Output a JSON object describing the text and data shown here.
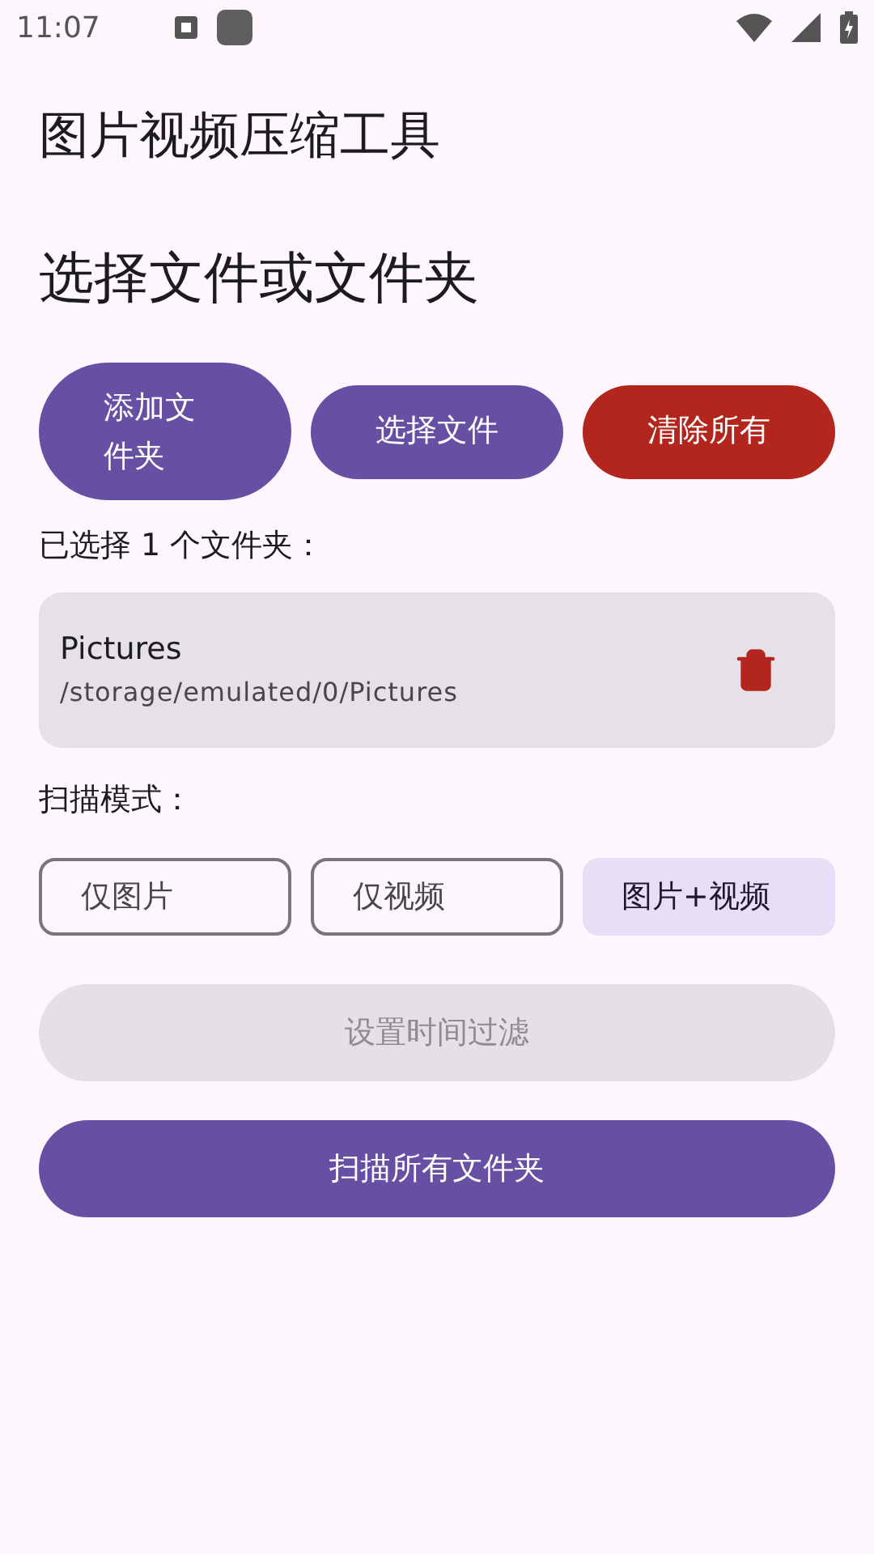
{
  "status_bar": {
    "time": "11:07"
  },
  "app_title": "图片视频压缩工具",
  "section_title": "选择文件或文件夹",
  "action_buttons": [
    {
      "label": "添加文件夹",
      "kind": "primary"
    },
    {
      "label": "选择文件",
      "kind": "primary"
    },
    {
      "label": "清除所有",
      "kind": "danger"
    }
  ],
  "selection_count": "已选择 1 个文件夹：",
  "folders": [
    {
      "name": "Pictures",
      "path": "/storage/emulated/0/Pictures"
    }
  ],
  "scan_mode_label": "扫描模式：",
  "scan_modes": [
    {
      "label": "仅图片",
      "selected": false
    },
    {
      "label": "仅视频",
      "selected": false
    },
    {
      "label": "图片+视频",
      "selected": true
    }
  ],
  "time_filter_button": {
    "label": "设置时间过滤",
    "disabled": true
  },
  "scan_button": {
    "label": "扫描所有文件夹",
    "disabled": false
  }
}
